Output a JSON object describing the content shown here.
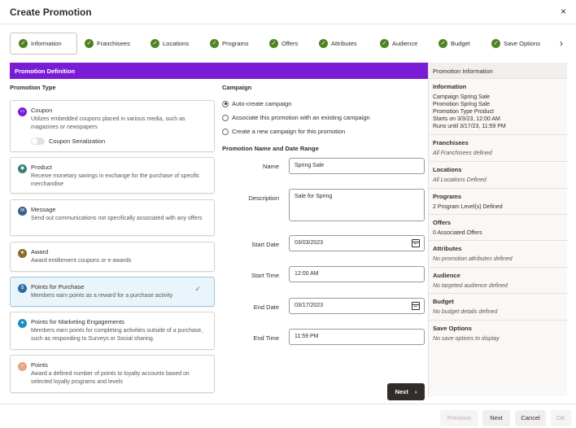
{
  "dialog": {
    "title": "Create Promotion",
    "close_glyph": "×"
  },
  "steps": [
    {
      "label": "Information",
      "completed": true,
      "active": true
    },
    {
      "label": "Franchisees",
      "completed": true,
      "active": false
    },
    {
      "label": "Locations",
      "completed": true,
      "active": false
    },
    {
      "label": "Programs",
      "completed": true,
      "active": false
    },
    {
      "label": "Offers",
      "completed": true,
      "active": false
    },
    {
      "label": "Attributes",
      "completed": true,
      "active": false
    },
    {
      "label": "Audience",
      "completed": true,
      "active": false
    },
    {
      "label": "Budget",
      "completed": true,
      "active": false
    },
    {
      "label": "Save Options",
      "completed": true,
      "active": false
    }
  ],
  "steps_more_glyph": "›",
  "check_glyph": "✓",
  "banner": "Promotion Definition",
  "promotion_type": {
    "label": "Promotion Type",
    "cards": [
      {
        "title": "Coupon",
        "desc": "Utilizes embedded coupons placed in various media, such as magazines or newspapers",
        "icon": "coupon-icon",
        "color": "#7a1cd5",
        "glyph": "▭",
        "selected": false
      },
      {
        "title": "Product",
        "desc": "Receive monetary savings in exchange for the purchase of specific merchandise",
        "icon": "product-icon",
        "color": "#3d7f7a",
        "glyph": "◆",
        "selected": false
      },
      {
        "title": "Message",
        "desc": "Send out communications not specifically associated with any offers",
        "icon": "message-icon",
        "color": "#385f8c",
        "glyph": "✉",
        "selected": false
      },
      {
        "title": "Award",
        "desc": "Award entitlement coupons or e-awards",
        "icon": "award-icon",
        "color": "#8b6a2b",
        "glyph": "★",
        "selected": false
      },
      {
        "title": "Points for Purchase",
        "desc": "Members earn points as a reward for a purchase activity",
        "icon": "points-purchase-icon",
        "color": "#2b6ca8",
        "glyph": "$",
        "selected": true
      },
      {
        "title": "Points for Marketing Engagements",
        "desc": "Members earn points for completing activities outside of a purchase, such as responding to Surveys or Social sharing.",
        "icon": "engagement-icon",
        "color": "#1f8fc0",
        "glyph": "●",
        "selected": false
      },
      {
        "title": "Points",
        "desc": "Award a defined number of points to loyalty accounts based on selected loyalty programs and levels",
        "icon": "points-icon",
        "color": "#e8a383",
        "glyph": "☆",
        "selected": false
      }
    ],
    "coupon_serialization": "Coupon Serialization"
  },
  "campaign": {
    "label": "Campaign",
    "options": [
      {
        "label": "Auto-create campaign",
        "selected": true
      },
      {
        "label": "Associate this promotion with an existing campaign",
        "selected": false
      },
      {
        "label": "Create a new campaign for this promotion",
        "selected": false
      }
    ]
  },
  "name_range": {
    "label": "Promotion Name and Date Range",
    "name_label": "Name",
    "name_value": "Spring Sale",
    "desc_label": "Description",
    "desc_value": "Sale for Spring",
    "start_date_label": "Start Date",
    "start_date_value": "03/03/2023",
    "start_time_label": "Start Time",
    "start_time_value": "12:00 AM",
    "end_date_label": "End Date",
    "end_date_value": "03/17/2023",
    "end_time_label": "End Time",
    "end_time_value": "11:59 PM"
  },
  "next_inner": {
    "label": "Next",
    "arrow": "›"
  },
  "info_panel": {
    "header": "Promotion Information",
    "information": {
      "title": "Information",
      "lines": [
        "Campaign Spring Sale",
        "Promotion Spring Sale",
        "Promotion Type Product",
        "Starts on 3/3/23, 12:00 AM",
        "Runs until 3/17/23, 11:59 PM"
      ]
    },
    "franchisees": {
      "title": "Franchisees",
      "value": "All Franchisees defined"
    },
    "locations": {
      "title": "Locations",
      "value": "All Locations Defined"
    },
    "programs": {
      "title": "Programs",
      "value": "2 Program Level(s) Defined"
    },
    "offers": {
      "title": "Offers",
      "value": "0 Associated Offers"
    },
    "attributes": {
      "title": "Attributes",
      "value": "No promotion attributes defined"
    },
    "audience": {
      "title": "Audience",
      "value": "No targeted audience defined"
    },
    "budget": {
      "title": "Budget",
      "value": "No budget details defined"
    },
    "save_options": {
      "title": "Save Options",
      "value": "No save options to display"
    }
  },
  "footer": {
    "previous": "Previous",
    "next": "Next",
    "cancel": "Cancel",
    "ok": "OK"
  }
}
